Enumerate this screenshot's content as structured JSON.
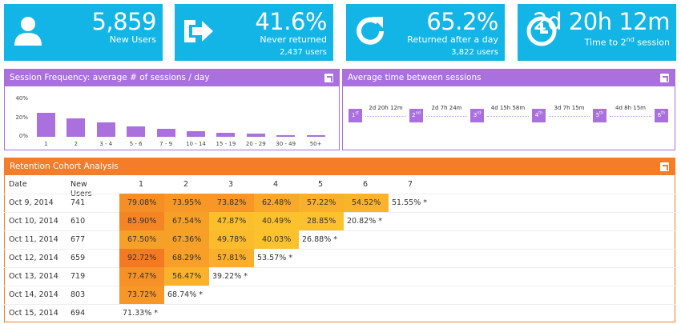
{
  "kpis": [
    {
      "value": "5,859",
      "label": "New Users",
      "sub": "",
      "icon": "user-icon"
    },
    {
      "value": "41.6%",
      "label": "Never returned",
      "sub": "2,437 users",
      "icon": "sign-out-icon"
    },
    {
      "value": "65.2%",
      "label": "Returned after a day",
      "sub": "3,822 users",
      "icon": "refresh-icon"
    },
    {
      "value": "2d 20h 12m",
      "label": "Time to 2",
      "label_sup": "nd",
      "label_end": " session",
      "sub": "",
      "icon": "clock-icon"
    }
  ],
  "session_frequency": {
    "title": "Session Frequency: average # of sessions / day",
    "chart_data": {
      "type": "bar",
      "categories": [
        "1",
        "2",
        "3 - 4",
        "5 - 6",
        "7 - 9",
        "10 - 14",
        "15 - 19",
        "20 - 29",
        "30 - 49",
        "50+"
      ],
      "values": [
        25.5,
        19.5,
        15.5,
        11,
        8.5,
        6,
        4,
        3,
        2,
        1.5
      ],
      "yticks": [
        "40%",
        "20%",
        "0%"
      ],
      "ylim": [
        0,
        40
      ],
      "grid": false,
      "color": "#a970de"
    }
  },
  "time_between": {
    "title": "Average time between sessions",
    "nodes": [
      {
        "num": "1",
        "sup": "st"
      },
      {
        "num": "2",
        "sup": "nd"
      },
      {
        "num": "3",
        "sup": "rd"
      },
      {
        "num": "4",
        "sup": "th"
      },
      {
        "num": "5",
        "sup": "th"
      },
      {
        "num": "6",
        "sup": "th"
      }
    ],
    "gaps": [
      "2d 20h 12m",
      "2d 7h 24m",
      "4d 15h 58m",
      "3d 7h 15m",
      "4d 8h 15m"
    ]
  },
  "retention": {
    "title": "Retention Cohort Analysis",
    "headers": [
      "Date",
      "New Users",
      "1",
      "2",
      "3",
      "4",
      "5",
      "6",
      "7"
    ],
    "rows": [
      {
        "date": "Oct 9, 2014",
        "users": "741",
        "values": [
          "79.08%",
          "73.95%",
          "73.82%",
          "62.48%",
          "57.22%",
          "54.52%",
          "51.55% *"
        ]
      },
      {
        "date": "Oct 10, 2014",
        "users": "610",
        "values": [
          "85.90%",
          "67.54%",
          "47.87%",
          "40.49%",
          "28.85%",
          "20.82% *"
        ]
      },
      {
        "date": "Oct 11, 2014",
        "users": "677",
        "values": [
          "67.50%",
          "67.36%",
          "49.78%",
          "40.03%",
          "26.88% *"
        ]
      },
      {
        "date": "Oct 12, 2014",
        "users": "659",
        "values": [
          "92.72%",
          "68.29%",
          "57.81%",
          "53.57% *"
        ]
      },
      {
        "date": "Oct 13, 2014",
        "users": "719",
        "values": [
          "77.47%",
          "56.47%",
          "39.22% *"
        ]
      },
      {
        "date": "Oct 14, 2014",
        "users": "803",
        "values": [
          "73.72%",
          "68.74% *"
        ]
      },
      {
        "date": "Oct 15, 2014",
        "users": "694",
        "values": [
          "71.33% *"
        ]
      }
    ],
    "heat_colors": {
      "low": "#fcc22e",
      "high": "#f27a22"
    }
  },
  "colors": {
    "kpi": "#12b5e5",
    "purple": "#a970de",
    "orange": "#f57c28"
  }
}
